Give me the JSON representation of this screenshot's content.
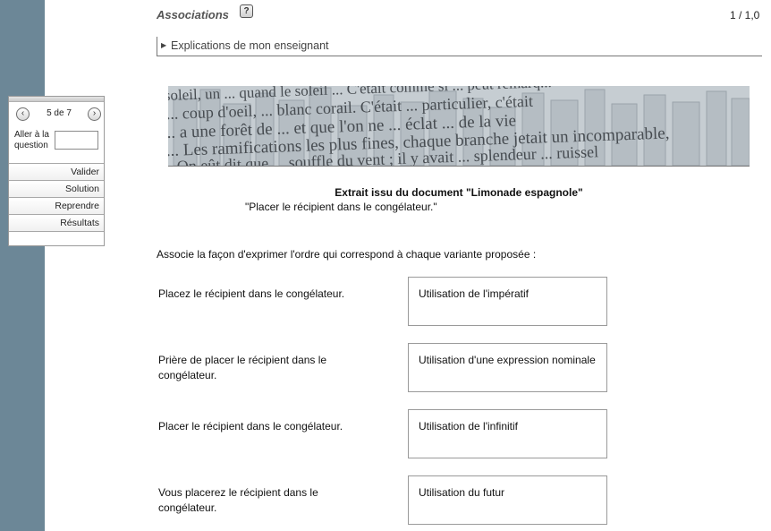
{
  "header": {
    "title": "Associations",
    "help_icon_label": "?",
    "page_counter": "1 / 1,0"
  },
  "explanations": {
    "label": "Explications de mon enseignant"
  },
  "nav": {
    "pager_text": "5 de 7",
    "goto_label": "Aller à la question",
    "goto_value": "",
    "items": [
      {
        "label": "Valider"
      },
      {
        "label": "Solution"
      },
      {
        "label": "Reprendre"
      },
      {
        "label": "Résultats"
      }
    ]
  },
  "banner": {
    "lines": [
      "soleil, un ... quand le soleil ... C'était comme si ... peut remarq...",
      "... coup d'oeil, ... blanc corail. C'était ... particulier, c'était",
      "... a une forêt de ... et que l'on ne ... éclat ... de la vie",
      "... Les ramifications les plus fines, chaque branche jetait un incomparable,",
      "... On eût dit que ... souffle du vent ; il y avait ... splendeur ... ruissel"
    ]
  },
  "document": {
    "title": "Extrait issu du document \"Limonade espagnole\"",
    "quote": "\"Placer le récipient dans le congélateur.\""
  },
  "instruction": "Associe la façon d'exprimer l'ordre qui correspond à chaque variante proposée :",
  "pairs": [
    {
      "left": "Placez le récipient dans le congélateur.",
      "right": "Utilisation de l'impératif"
    },
    {
      "left": "Prière de placer le récipient dans le congélateur.",
      "right": "Utilisation d'une expression nominale"
    },
    {
      "left": "Placer le récipient dans le congélateur.",
      "right": "Utilisation de l'infinitif"
    },
    {
      "left": "Vous placerez le récipient dans le congélateur.",
      "right": "Utilisation du futur"
    }
  ]
}
